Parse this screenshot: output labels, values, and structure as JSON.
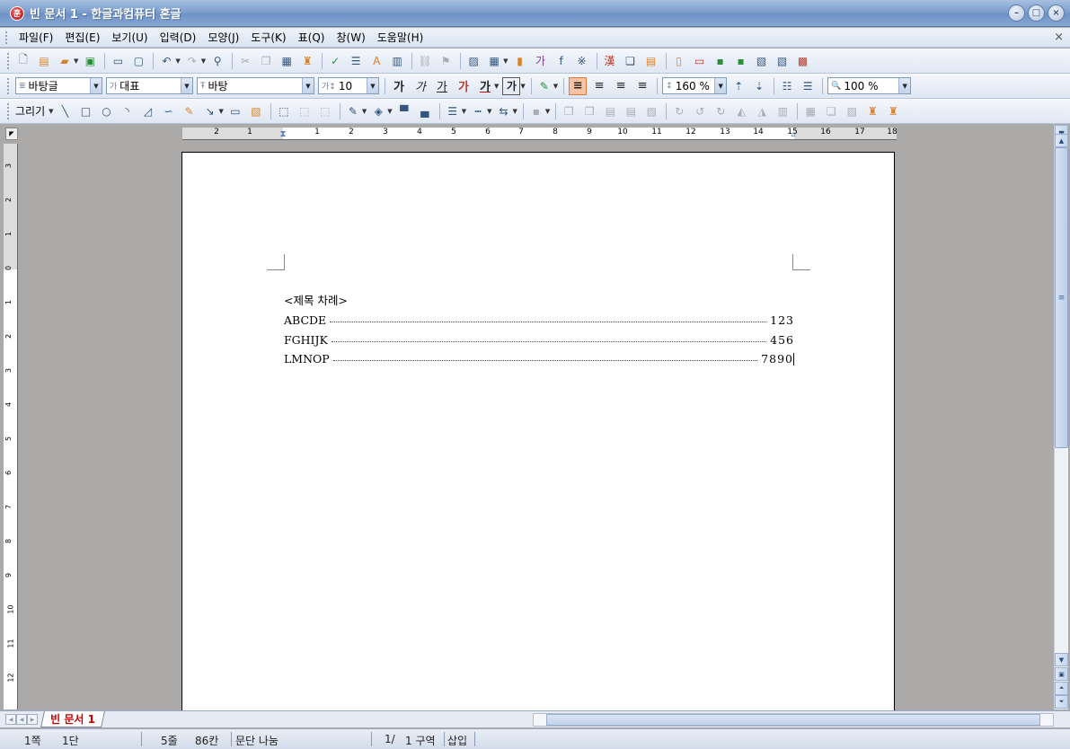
{
  "window": {
    "app_icon_glyph": "훈",
    "title": "빈 문서 1 - 한글과컴퓨터 혼글",
    "minimize": "–",
    "maximize": "□",
    "close": "×"
  },
  "menu": {
    "items": [
      "파일(F)",
      "편집(E)",
      "보기(U)",
      "입력(D)",
      "모양(J)",
      "도구(K)",
      "표(Q)",
      "창(W)",
      "도움말(H)"
    ],
    "close": "×"
  },
  "toolbar_format": {
    "style": "바탕글",
    "style_icon": "≣",
    "lang": "대표",
    "lang_icon": "가",
    "font": "바탕",
    "font_icon": "Ŧ",
    "size": "10",
    "size_icon": "가↕",
    "bold": "가",
    "italic": "가",
    "underline": "가",
    "strike": "가",
    "color_text": "가",
    "shade_text": "가",
    "line_spacing": "160 %",
    "zoom": "100 %",
    "zoom_icon": "🔍"
  },
  "toolbar_draw": {
    "label": "그리기"
  },
  "ruler": {
    "h_numbers": [
      "2",
      "1",
      "1",
      "2",
      "3",
      "4",
      "5",
      "6",
      "7",
      "8",
      "9",
      "10",
      "11",
      "12",
      "13",
      "14",
      "15",
      "16",
      "17",
      "18"
    ],
    "v_numbers": [
      "3",
      "2",
      "1",
      "0",
      "1",
      "2",
      "3",
      "4",
      "5",
      "6",
      "7",
      "8",
      "9",
      "10",
      "11",
      "12"
    ]
  },
  "document": {
    "heading": "<제목 차례>",
    "toc": [
      {
        "entry": "ABCDE",
        "page": "123"
      },
      {
        "entry": "FGHIJK",
        "page": "456"
      },
      {
        "entry": "LMNOP",
        "page": "7890"
      }
    ]
  },
  "tabs": {
    "active": "빈 문서 1"
  },
  "status": {
    "page": "1쪽",
    "column": "1단",
    "line": "5줄",
    "char": "86칸",
    "mode_break": "문단 나눔",
    "section_page": "1/",
    "section": "1 구역",
    "insert": "삽입"
  }
}
